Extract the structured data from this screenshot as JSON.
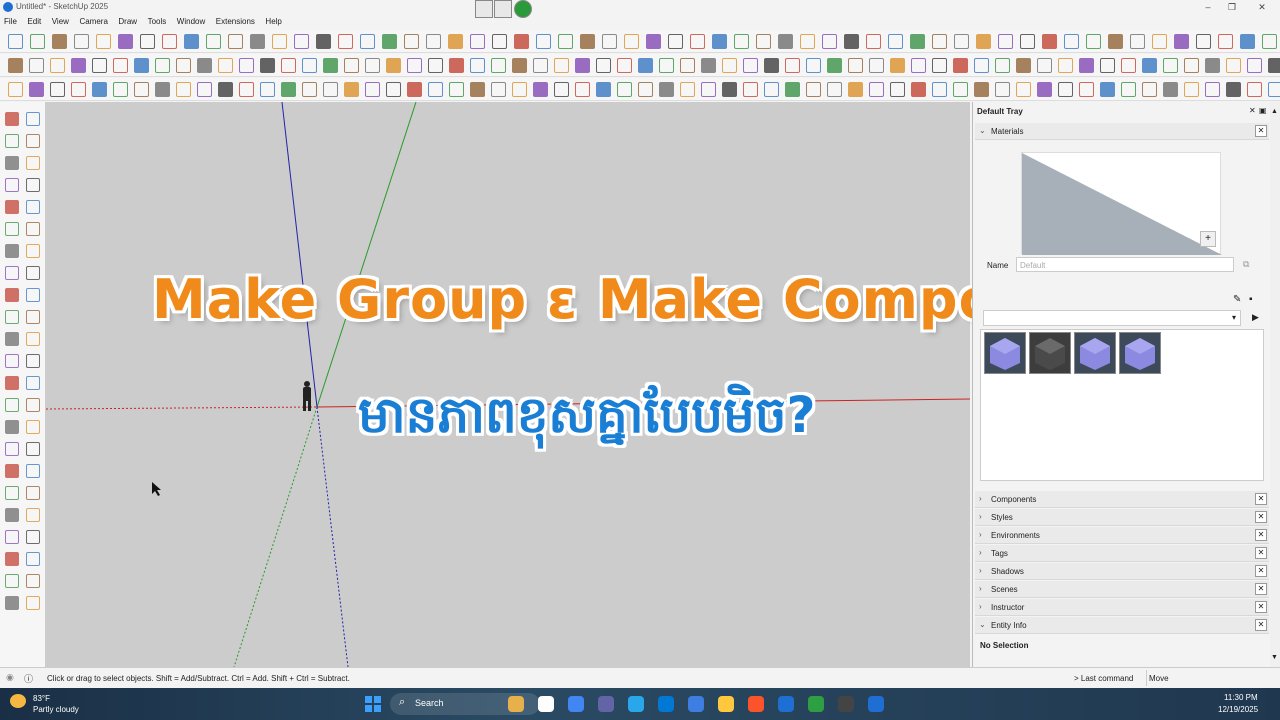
{
  "window": {
    "title": "Untitled* - SketchUp 2025"
  },
  "menu": [
    "File",
    "Edit",
    "View",
    "Camera",
    "Draw",
    "Tools",
    "Window",
    "Extensions",
    "Help"
  ],
  "overlay": {
    "title": "Make Group ɛ Make Component",
    "khmer": "មានភាពខុសគ្នាបែបមិច?"
  },
  "tray": {
    "title": "Default Tray",
    "materials": {
      "label": "Materials",
      "name_label": "Name",
      "name_placeholder": "Default"
    },
    "panels": [
      "Components",
      "Styles",
      "Environments",
      "Tags",
      "Shadows",
      "Scenes",
      "Instructor",
      "Entity Info"
    ],
    "entity_info": {
      "value": "No Selection"
    }
  },
  "status": {
    "message": "Click or drag to select objects. Shift = Add/Subtract. Ctrl = Add. Shift + Ctrl = Subtract.",
    "last_command_label": "> Last command",
    "last_command_value": "Move"
  },
  "taskbar": {
    "weather_temp": "83°F",
    "weather_desc": "Partly cloudy",
    "search_placeholder": "Search",
    "time": "11:30 PM",
    "date": "12/19/2025"
  },
  "colors": {
    "title_orange": "#f08a1a",
    "khmer_blue": "#1a7fd4",
    "viewport_bg": "#cccccc",
    "axis_red": "#cc2222",
    "axis_green": "#2a9a2a",
    "axis_blue": "#2222aa"
  }
}
